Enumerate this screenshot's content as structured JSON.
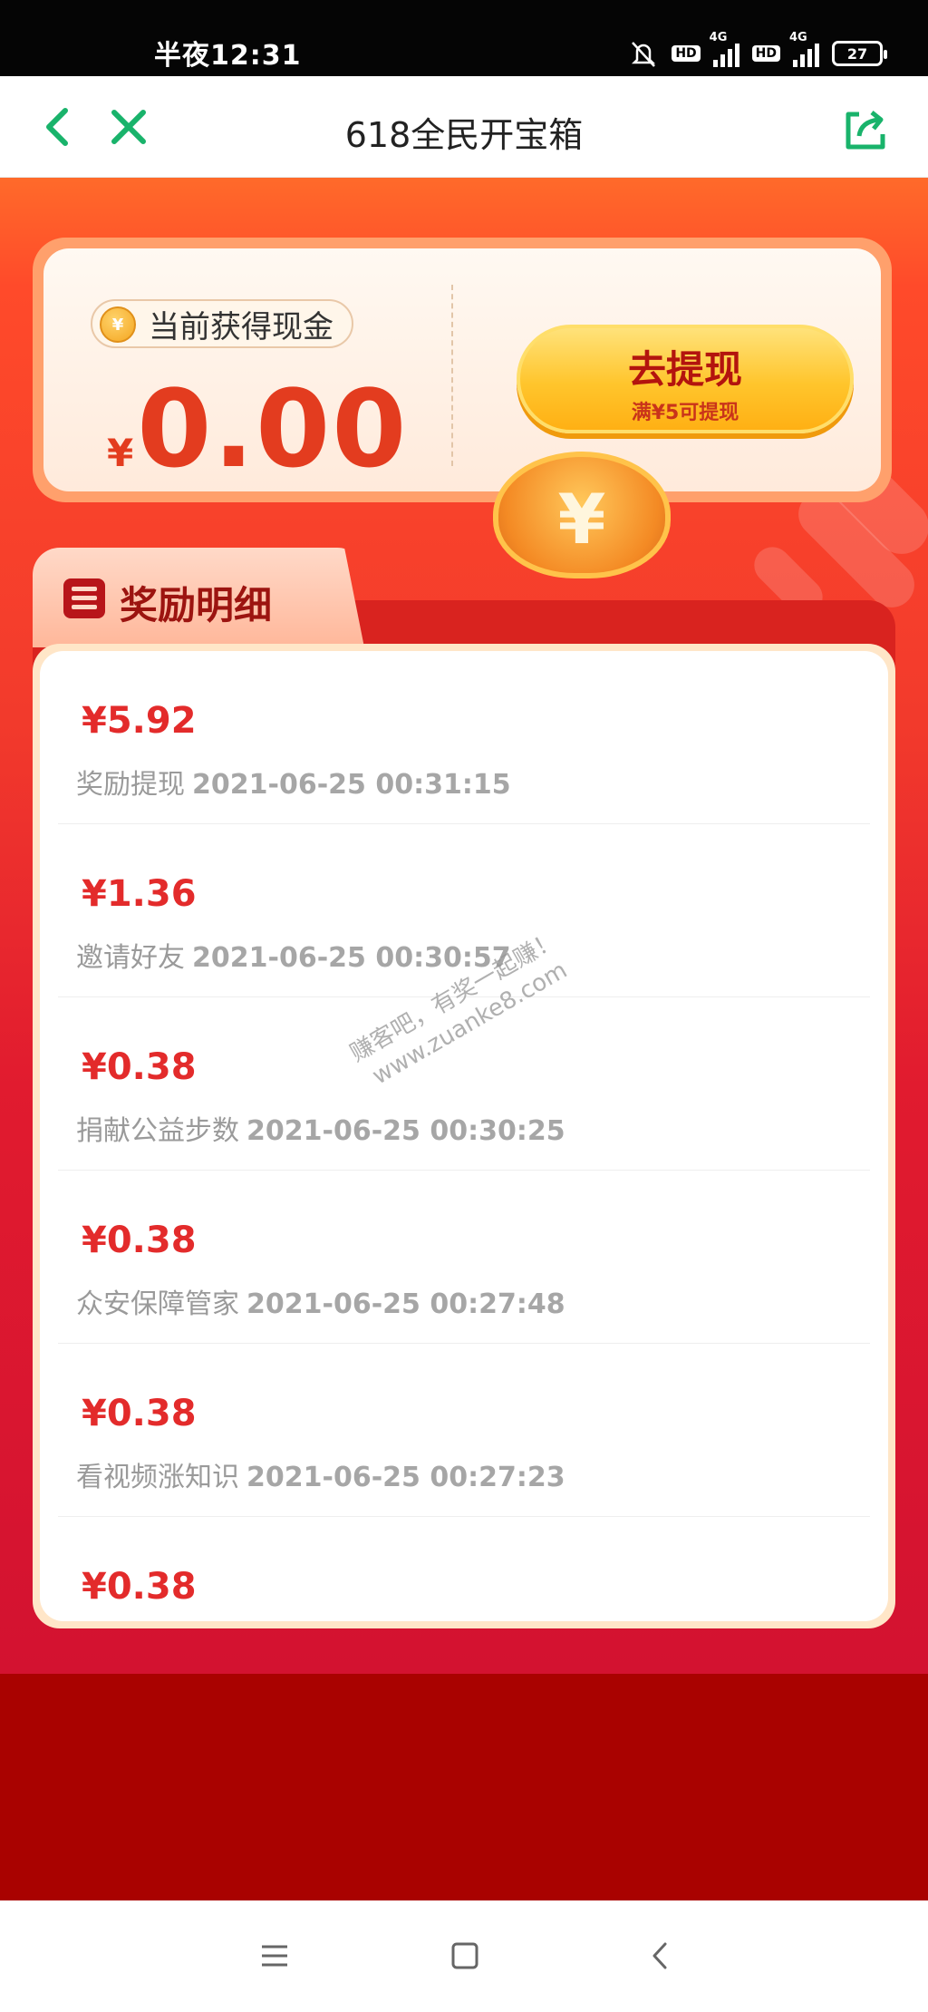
{
  "status_bar": {
    "time": "半夜12:31",
    "hd_1": "HD",
    "net_1": "4G",
    "hd_2": "HD",
    "net_2": "4G",
    "battery": "27"
  },
  "app_bar": {
    "title": "618全民开宝箱",
    "accent_color": "#19b36b"
  },
  "cash": {
    "label": "当前获得现金",
    "currency": "¥",
    "amount": "0.00",
    "withdraw_label": "去提现",
    "withdraw_sub": "满¥5可提现"
  },
  "rewards": {
    "title": "奖励明细",
    "items": [
      {
        "amount": "¥5.92",
        "desc": "奖励提现",
        "time": "2021-06-25 00:31:15"
      },
      {
        "amount": "¥1.36",
        "desc": "邀请好友",
        "time": "2021-06-25 00:30:57"
      },
      {
        "amount": "¥0.38",
        "desc": "捐献公益步数",
        "time": "2021-06-25 00:30:25"
      },
      {
        "amount": "¥0.38",
        "desc": "众安保障管家",
        "time": "2021-06-25 00:27:48"
      },
      {
        "amount": "¥0.38",
        "desc": "看视频涨知识",
        "time": "2021-06-25 00:27:23"
      },
      {
        "amount": "¥0.38",
        "desc": "",
        "time": ""
      }
    ]
  },
  "watermark": {
    "line1": "赚客吧，有奖一起赚！",
    "line2": "www.zuanke8.com"
  },
  "nav": {
    "menu_icon": "menu-icon",
    "home_icon": "home-icon",
    "back_icon": "back-icon"
  }
}
